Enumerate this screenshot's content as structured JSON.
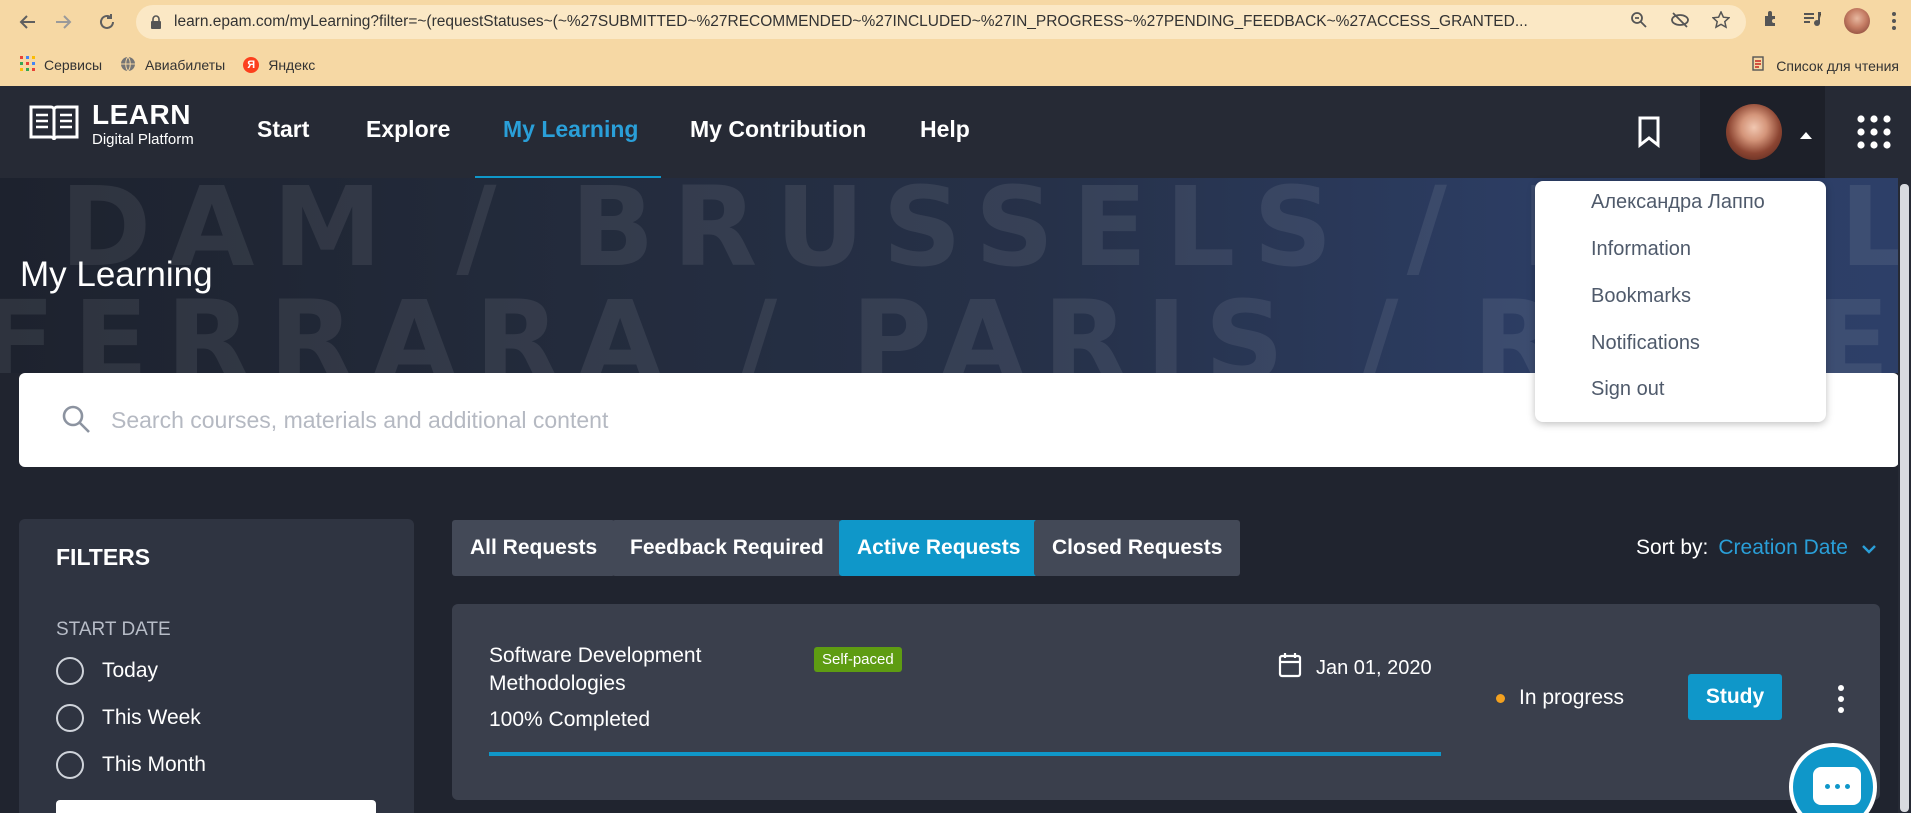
{
  "browser": {
    "url": "learn.epam.com/myLearning?filter=~(requestStatuses~(~%27SUBMITTED~%27RECOMMENDED~%27INCLUDED~%27IN_PROGRESS~%27PENDING_FEEDBACK~%27ACCESS_GRANTED...",
    "bookmarks": [
      "Сервисы",
      "Авиабилеты",
      "Яндекс"
    ],
    "reading_list": "Список для чтения"
  },
  "app": {
    "logo_title": "LEARN",
    "logo_subtitle": "Digital Platform",
    "nav": [
      "Start",
      "Explore",
      "My Learning",
      "My Contribution",
      "Help"
    ]
  },
  "banner": {
    "words_line1": "DAM / BRUSSELS / DUBLIN / ATS",
    "words_line2": "FERRARA / PARIS / ROME / MO",
    "title": "My Learning"
  },
  "search": {
    "placeholder": "Search courses, materials and additional content"
  },
  "filters": {
    "title": "FILTERS",
    "start_date_label": "START DATE",
    "options": [
      "Today",
      "This Week",
      "This Month"
    ]
  },
  "tabs": [
    "All Requests",
    "Feedback Required",
    "Active Requests",
    "Closed Requests"
  ],
  "sort": {
    "label": "Sort by:",
    "value": "Creation Date"
  },
  "card": {
    "title": "Software Development Methodologies",
    "badge": "Self-paced",
    "progress_text": "100% Completed",
    "progress": 100,
    "date": "Jan 01, 2020",
    "status": "In progress",
    "action": "Study"
  },
  "user_menu": {
    "items": [
      "Александра Лаппо",
      "Information",
      "Bookmarks",
      "Notifications",
      "Sign out"
    ]
  },
  "colors": {
    "accent": "#0f97c9",
    "badge": "#5e9c12",
    "status_dot": "#f3a11f",
    "chrome": "#f6d8a4"
  }
}
